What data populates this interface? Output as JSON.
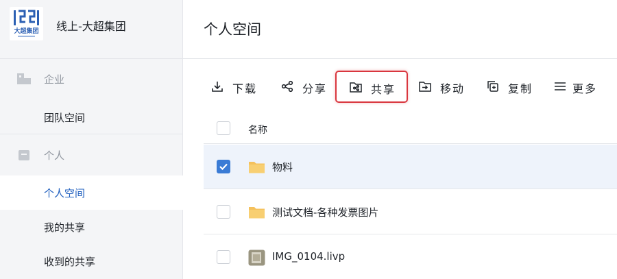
{
  "org": {
    "name": "线上-大超集团",
    "logo_text": "大超集团"
  },
  "sidebar": {
    "groups": [
      {
        "label": "企业",
        "items": [
          {
            "label": "团队空间"
          }
        ]
      },
      {
        "label": "个人",
        "items": [
          {
            "label": "个人空间"
          },
          {
            "label": "我的共享"
          },
          {
            "label": "收到的共享"
          }
        ]
      }
    ],
    "active_item": "个人空间"
  },
  "page": {
    "title": "个人空间"
  },
  "toolbar": {
    "download": "下载",
    "share": "分享",
    "cooperate_share": "共享",
    "move": "移动",
    "copy": "复制",
    "more": "更多"
  },
  "table": {
    "header": {
      "name": "名称"
    },
    "rows": [
      {
        "name": "物料",
        "type": "folder",
        "checked": true
      },
      {
        "name": "测试文档-各种发票图片",
        "type": "folder",
        "checked": false
      },
      {
        "name": "IMG_0104.livp",
        "type": "image",
        "checked": false
      }
    ]
  },
  "colors": {
    "accent": "#3a7bd5",
    "highlight": "#d9363e",
    "folder": "#f5c15c"
  }
}
